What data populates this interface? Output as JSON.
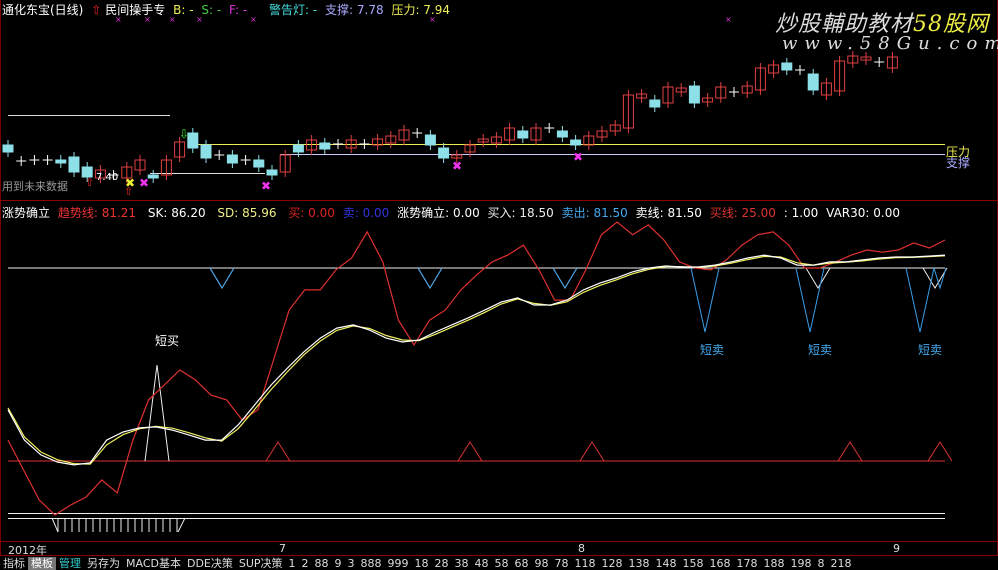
{
  "header": {
    "stock": "通化东宝(日线)",
    "formula": "民间操手专",
    "b": "B: -",
    "s": "S: -",
    "f": "F: -",
    "warning": "警告灯: -",
    "support": "支撑: 7.78",
    "pressure": "压力: 7.94"
  },
  "watermark": {
    "line1a": "炒股輔助教材",
    "line1b": "58股网",
    "line2": "www.58Gu.com"
  },
  "price_panel": {
    "future_data_note": "用到未来数据",
    "low_label": "7.40",
    "pressure_label": "压力",
    "support_label": "支撑",
    "support_value": 7.78,
    "pressure_value": 7.94,
    "candles": [
      [
        7.94,
        7.8
      ],
      [
        7.62,
        7.62
      ],
      [
        7.64,
        7.64
      ],
      [
        7.64,
        7.64
      ],
      [
        7.64,
        7.58
      ],
      [
        7.7,
        7.4
      ],
      [
        7.5,
        7.3
      ],
      [
        7.28,
        7.44
      ],
      [
        7.34,
        7.34
      ],
      [
        7.28,
        7.5
      ],
      [
        7.44,
        7.64
      ],
      [
        7.34,
        7.28
      ],
      [
        7.34,
        7.64
      ],
      [
        7.7,
        8.0
      ],
      [
        8.18,
        7.88
      ],
      [
        7.94,
        7.68
      ],
      [
        7.74,
        7.74
      ],
      [
        7.74,
        7.58
      ],
      [
        7.64,
        7.64
      ],
      [
        7.64,
        7.5
      ],
      [
        7.44,
        7.34
      ],
      [
        7.4,
        7.74
      ],
      [
        7.94,
        7.8
      ],
      [
        7.84,
        8.04
      ],
      [
        7.98,
        7.86
      ],
      [
        7.96,
        7.96
      ],
      [
        7.88,
        8.04
      ],
      [
        7.96,
        7.96
      ],
      [
        7.94,
        8.06
      ],
      [
        7.98,
        8.12
      ],
      [
        8.04,
        8.24
      ],
      [
        8.18,
        8.18
      ],
      [
        8.14,
        7.94
      ],
      [
        7.88,
        7.68
      ],
      [
        7.68,
        7.74
      ],
      [
        7.8,
        7.94
      ],
      [
        8.0,
        8.06
      ],
      [
        7.98,
        8.1
      ],
      [
        8.04,
        8.28
      ],
      [
        8.22,
        8.08
      ],
      [
        8.04,
        8.28
      ],
      [
        8.28,
        8.28
      ],
      [
        8.22,
        8.1
      ],
      [
        8.04,
        7.94
      ],
      [
        7.94,
        8.12
      ],
      [
        8.1,
        8.22
      ],
      [
        8.22,
        8.34
      ],
      [
        8.28,
        8.94
      ],
      [
        8.88,
        8.96
      ],
      [
        8.84,
        8.7
      ],
      [
        8.78,
        9.1
      ],
      [
        9.0,
        9.08
      ],
      [
        9.12,
        8.78
      ],
      [
        8.8,
        8.88
      ],
      [
        8.88,
        9.1
      ],
      [
        9.0,
        9.0
      ],
      [
        8.98,
        9.12
      ],
      [
        9.04,
        9.48
      ],
      [
        9.38,
        9.54
      ],
      [
        9.58,
        9.44
      ],
      [
        9.44,
        9.44
      ],
      [
        9.36,
        9.04
      ],
      [
        8.94,
        9.18
      ],
      [
        9.02,
        9.62
      ],
      [
        9.58,
        9.72
      ],
      [
        9.64,
        9.7
      ],
      [
        9.6,
        9.6
      ],
      [
        9.48,
        9.7
      ]
    ]
  },
  "indicator": {
    "name": "涨势确立",
    "trend": "趋势线: 81.21",
    "sk": "SK: 86.20",
    "sd": "SD: 85.96",
    "buy": "买: 0.00",
    "sell": "卖: 0.00",
    "rise": "涨势确立: 0.00",
    "buy_in": "买入: 18.50",
    "sell_out": "卖出: 81.50",
    "sell_line": "卖线: 81.50",
    "buy_line": "买线: 25.00",
    "blank": ": 1.00",
    "var30": "VAR30: 0.00",
    "short_buy": "短买",
    "short_sell": [
      "短卖",
      "短卖",
      "短卖"
    ],
    "colors": {
      "trend": "#e03030",
      "sk": "#ffffff",
      "sd": "#f0f060",
      "sell_signal": "#3a9ee8"
    },
    "trend_series": [
      26.5,
      17.2,
      7.9,
      3.2,
      6.3,
      8.8,
      14.1,
      10.1,
      26.5,
      39.0,
      43.6,
      48.3,
      45.2,
      40.5,
      39.0,
      32.7,
      35.9,
      51.4,
      66.9,
      73.2,
      73.2,
      79.4,
      83.1,
      91.2,
      81.9,
      63.8,
      56.1,
      63.8,
      66.9,
      73.2,
      77.8,
      81.9,
      84.0,
      87.1,
      79.4,
      70.0,
      70.0,
      79.4,
      90.3,
      94.3,
      90.3,
      93.4,
      88.7,
      81.9,
      80.0,
      79.4,
      82.5,
      87.1,
      90.3,
      91.2,
      87.1,
      80.0,
      80.0,
      81.9,
      84.0,
      85.6,
      84.9,
      85.6,
      87.8,
      86.2,
      88.7
    ],
    "sk_series": [
      35.9,
      26.5,
      21.9,
      19.7,
      18.8,
      19.4,
      26.5,
      29.0,
      30.3,
      30.6,
      29.6,
      28.1,
      26.5,
      26.5,
      31.2,
      37.4,
      43.6,
      48.9,
      53.9,
      58.2,
      61.3,
      62.3,
      60.7,
      58.2,
      57.0,
      57.6,
      60.1,
      62.3,
      64.5,
      66.9,
      69.4,
      70.7,
      68.5,
      68.5,
      70.0,
      73.2,
      75.3,
      76.9,
      78.8,
      80.0,
      80.6,
      80.3,
      80.3,
      80.9,
      81.9,
      83.1,
      84.0,
      83.1,
      80.9,
      80.9,
      81.9,
      81.9,
      82.5,
      83.1,
      83.4,
      83.4,
      83.7,
      84.0
    ],
    "sd_series": [
      36.5,
      27.5,
      22.8,
      20.4,
      19.2,
      19.0,
      25.0,
      28.2,
      30.0,
      30.8,
      30.2,
      28.8,
      27.2,
      26.2,
      30.0,
      36.0,
      42.2,
      47.8,
      53.0,
      57.3,
      60.6,
      62.0,
      61.2,
      59.0,
      57.6,
      57.4,
      59.4,
      61.6,
      63.8,
      66.2,
      68.8,
      70.4,
      69.0,
      68.4,
      69.5,
      72.4,
      74.6,
      76.3,
      78.2,
      79.6,
      80.4,
      80.4,
      80.2,
      80.6,
      81.5,
      82.6,
      83.6,
      83.4,
      81.6,
      80.9,
      81.5,
      81.8,
      82.2,
      82.8,
      83.2,
      83.3,
      83.5,
      83.8
    ],
    "upper_line": 80,
    "lower_line": 20
  },
  "date_axis": {
    "year": "2012年",
    "m7": "7",
    "m8": "8",
    "m9": "9"
  },
  "bottom_tabs": [
    "指标",
    "模板",
    "管理",
    "另存为",
    "MACD基本",
    "DDE决策",
    "SUP决策",
    "1",
    "2",
    "88",
    "9",
    "3",
    "888",
    "999",
    "18",
    "28",
    "38",
    "48",
    "58",
    "68",
    "98",
    "78",
    "118",
    "128",
    "138",
    "148",
    "158",
    "168",
    "178",
    "188",
    "198",
    "8",
    "218"
  ]
}
